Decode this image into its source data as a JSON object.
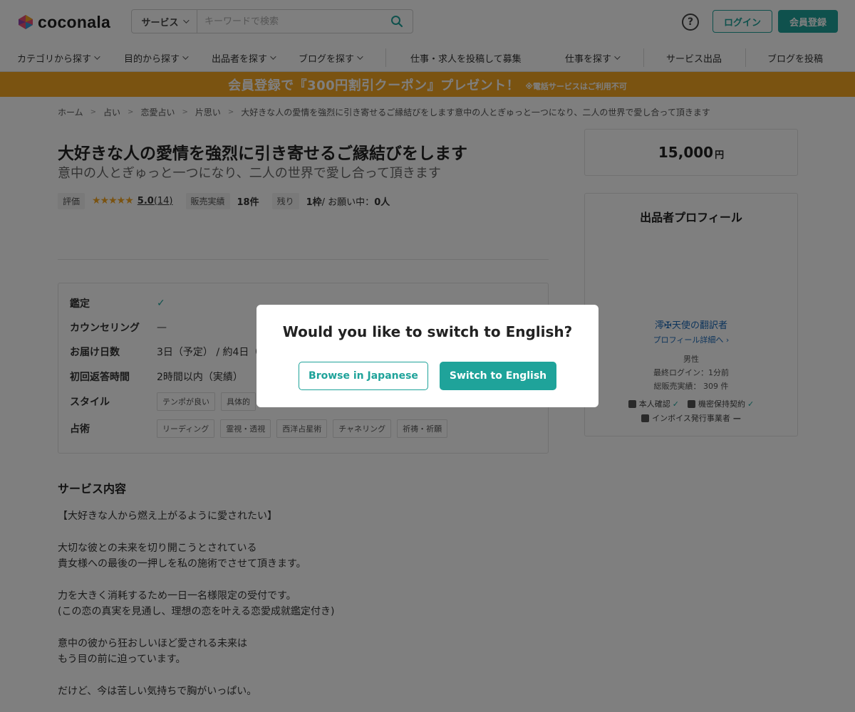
{
  "header": {
    "logo_text": "coconala",
    "search_category": "サービス",
    "search_placeholder": "キーワードで検索",
    "help_symbol": "?",
    "login_label": "ログイン",
    "signup_label": "会員登録"
  },
  "nav": {
    "items": [
      "カテゴリから探す",
      "目的から探す",
      "出品者を探す",
      "ブログを探す",
      "仕事・求人を投稿して募集",
      "仕事を探す",
      "サービス出品",
      "ブログを投稿"
    ]
  },
  "banner": {
    "main": "会員登録で『300円割引クーポン』プレゼント！",
    "note": "※電話サービスはご利用不可"
  },
  "breadcrumb": [
    "ホーム",
    "占い",
    "恋愛占い",
    "片思い",
    "大好きな人の愛情を強烈に引き寄せるご縁結びをします意中の人とぎゅっと一つになり、二人の世界で愛し合って頂きます"
  ],
  "service": {
    "title": "大好きな人の愛情を強烈に引き寄せるご縁結びをします",
    "subtitle": "意中の人とぎゅっと一つになり、二人の世界で愛し合って頂きます",
    "rating_label": "評価",
    "stars": "★★★★★",
    "rating_value": "5.0",
    "rating_count": "(14)",
    "sales_label": "販売実績",
    "sales_value": "18件",
    "remaining_label": "残り",
    "remaining_value": "1枠",
    "remaining_suffix": " / お願い中：",
    "requesting_value": "0人"
  },
  "specs": {
    "appraisal_label": "鑑定",
    "appraisal_value": "✓",
    "counseling_label": "カウンセリング",
    "counseling_value": "—",
    "delivery_label": "お届け日数",
    "delivery_value": "3日（予定） / 約4日（",
    "response_label": "初回返答時間",
    "response_value": "2時間以内（実績）",
    "style_label": "スタイル",
    "style_tags": [
      "テンポが良い",
      "具体的"
    ],
    "method_label": "占術",
    "method_tags": [
      "リーディング",
      "霊視・透視",
      "西洋占星術",
      "チャネリング",
      "祈祷・祈願"
    ]
  },
  "content": {
    "section_title": "サービス内容",
    "lines": [
      "【大好きな人から燃え上がるように愛されたい】",
      "大切な彼との未来を切り開こうとされている",
      "貴女様への最後の一押しを私の施術でさせて頂きます。",
      "力を大きく消耗するため一日一名様限定の受付です。",
      "(この恋の真実を見通し、理想の恋を叶える恋愛成就鑑定付き)",
      "意中の彼から狂おしいほど愛される未来は",
      "もう目の前に迫っています。",
      "だけど、今は苦しい気持ちで胸がいっぱい。"
    ]
  },
  "price": {
    "value": "15,000",
    "unit": "円"
  },
  "profile": {
    "title": "出品者プロフィール",
    "name": "澪✠天使の翻訳者",
    "detail_link": "プロフィール詳細へ ›",
    "gender": "男性",
    "last_login": "最終ログイン：1分前",
    "total_sales": "総販売実績： 309 件",
    "identity_label": "本人確認",
    "nda_label": "機密保持契約",
    "invoice_label": "インボイス発行事業者",
    "invoice_value": "—"
  },
  "modal": {
    "title": "Would you like to switch to English?",
    "secondary_label": "Browse in Japanese",
    "primary_label": "Switch to English"
  },
  "colors": {
    "accent": "#1fa39a",
    "banner": "#f5a623",
    "star": "#f5a623",
    "link": "#1d6ab8"
  }
}
